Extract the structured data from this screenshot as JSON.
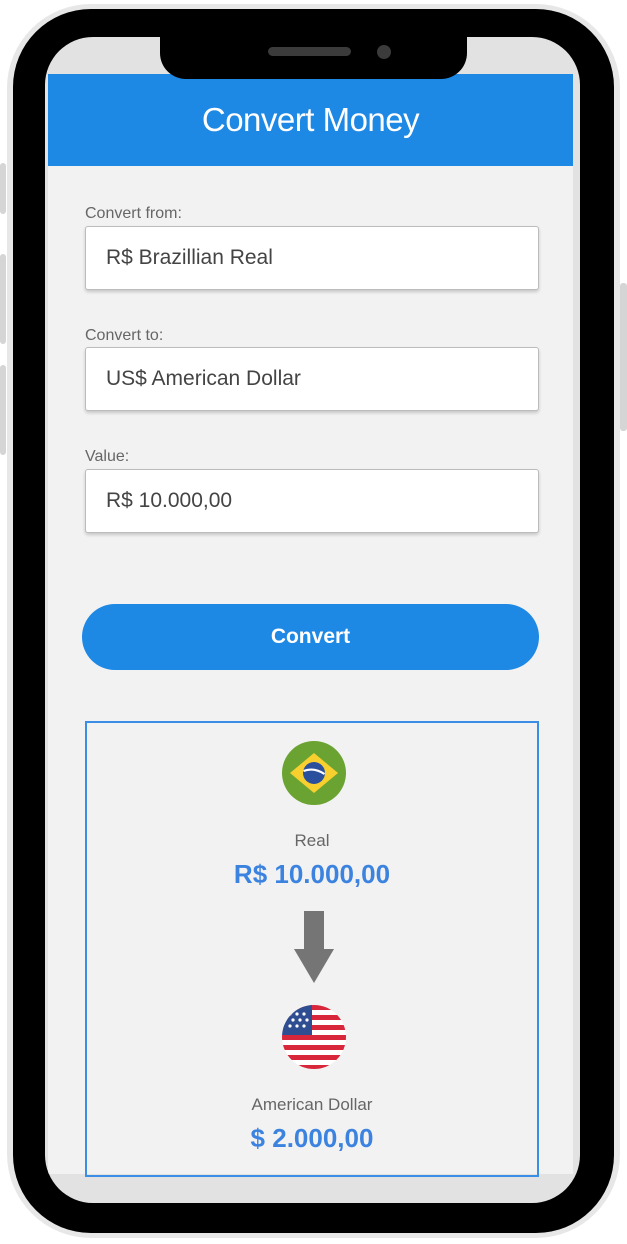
{
  "header": {
    "title": "Convert Money"
  },
  "form": {
    "from_label": "Convert from:",
    "from_value": "R$ Brazillian Real",
    "to_label": "Convert to:",
    "to_value": "US$ American Dollar",
    "value_label": "Value:",
    "value_value": "R$ 10.000,00",
    "convert_label": "Convert"
  },
  "result": {
    "from_icon": "brazil-flag-icon",
    "from_name": "Real",
    "from_amount": "R$ 10.000,00",
    "arrow_icon": "arrow-down-icon",
    "to_icon": "usa-flag-icon",
    "to_name": "American Dollar",
    "to_amount": "$ 2.000,00"
  },
  "colors": {
    "primary": "#1e88e5",
    "amount": "#3c83e0",
    "background": "#f2f2f2"
  }
}
